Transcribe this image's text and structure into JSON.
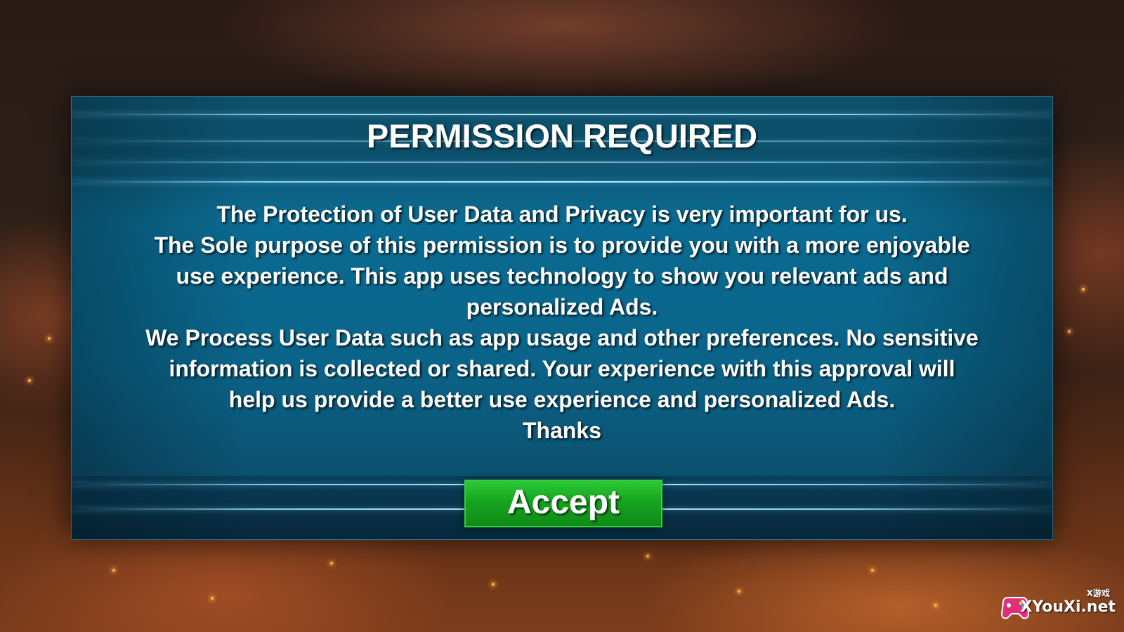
{
  "dialog": {
    "title": "PERMISSION REQUIRED",
    "body_lines": [
      "The Protection of User Data and Privacy is very important for us.",
      "The Sole purpose of this permission is to provide you with a more enjoyable",
      "use experience. This app uses technology to show you relevant ads and",
      "personalized Ads.",
      "We Process User Data such as app usage and other preferences. No sensitive",
      "information is collected or shared. Your experience with this approval will",
      "help us provide a better use experience  and personalized Ads.",
      "Thanks"
    ],
    "accept_label": "Accept"
  },
  "watermark": {
    "site": "XYouXi.net",
    "sub": "X游戏",
    "icon": "gamepad-icon"
  },
  "colors": {
    "dialog_blue": "#0b6b92",
    "accept_green": "#16a51f",
    "streak_blue": "#a0e6ff"
  }
}
